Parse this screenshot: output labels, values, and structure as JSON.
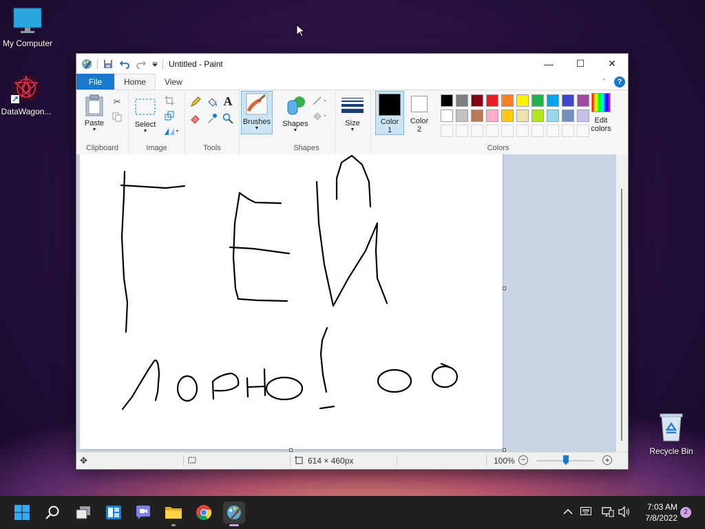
{
  "desktop": {
    "icons": [
      {
        "label": "My Computer"
      },
      {
        "label": "DataWagon..."
      },
      {
        "label": "Recycle Bin"
      }
    ]
  },
  "window": {
    "title": "Untitled - Paint",
    "tabs": {
      "file": "File",
      "home": "Home",
      "view": "View"
    }
  },
  "ribbon": {
    "clipboard": {
      "label": "Clipboard",
      "paste": "Paste"
    },
    "image": {
      "label": "Image",
      "select": "Select"
    },
    "tools": {
      "label": "Tools"
    },
    "brushes": {
      "label": "Brushes"
    },
    "shapes": {
      "label": "Shapes",
      "button": "Shapes"
    },
    "size": {
      "label": "Size"
    },
    "colors": {
      "label": "Colors",
      "color1": "Color\n1",
      "color2": "Color\n2",
      "color1_value": "#000000",
      "color2_value": "#ffffff",
      "edit": "Edit colors",
      "palette_row1": [
        "#000000",
        "#7f7f7f",
        "#880015",
        "#ed1c24",
        "#ff7f27",
        "#fff200",
        "#22b14c",
        "#00a2e8",
        "#3f48cc",
        "#a349a4"
      ],
      "palette_row2": [
        "#ffffff",
        "#c3c3c3",
        "#b97a57",
        "#ffaec9",
        "#ffc90e",
        "#efe4b0",
        "#b5e61d",
        "#99d9ea",
        "#7092be",
        "#c8bfe7"
      ]
    }
  },
  "status": {
    "size": "614 × 460px",
    "zoom": "100%"
  },
  "taskbar": {
    "time": "7:03 AM",
    "date": "7/8/2022",
    "notifications": "2"
  }
}
